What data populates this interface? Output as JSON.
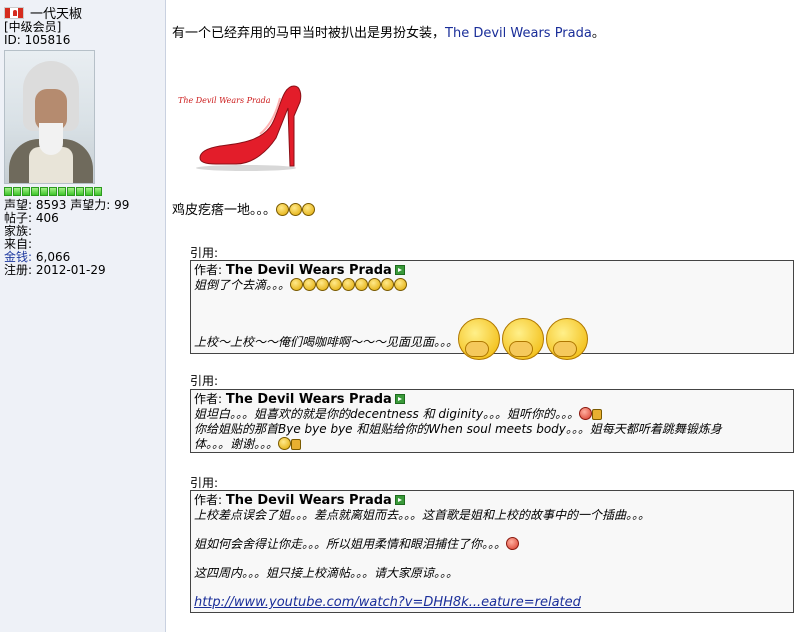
{
  "user": {
    "name": "一代天椒",
    "rank": "[中级会员]",
    "id_line": "ID: 105816",
    "stats": [
      {
        "label": "声望:",
        "value": "8593",
        "label2": "声望力:",
        "value2": "99"
      },
      {
        "label": "帖子:",
        "value": "406"
      },
      {
        "label": "家族:",
        "value": ""
      },
      {
        "label": "来自:",
        "value": ""
      },
      {
        "label": "金钱:",
        "value": "6,066",
        "label_link": true
      },
      {
        "label": "注册:",
        "value": "2012-01-29"
      }
    ],
    "reputation_bar_segments": 11,
    "flag": "canada-flag-icon"
  },
  "post": {
    "intro_text": "有一个已经弃用的马甲当时被扒出是男扮女装，",
    "intro_link": "The Devil Wears Prada",
    "intro_end": "。",
    "image_caption": "The Devil Wears Prada",
    "reaction_text": "鸡皮疙瘩一地。。。",
    "quotes": [
      {
        "label": "引用:",
        "author_prefix": "作者:",
        "author": "The Devil Wears Prada",
        "lines": [
          "姐倒了个去滴。。。",
          "",
          "上校～上校～～俺们喝咖啡啊～～～见面见面。。。"
        ]
      },
      {
        "label": "引用:",
        "author_prefix": "作者:",
        "author": "The Devil Wears Prada",
        "lines": [
          "姐坦白。。。姐喜欢的就是你的decentness 和 diginity。。。姐听你的。。。",
          "你给姐贴的那首Bye bye bye 和姐贴给你的When soul meets body。。。姐每天都听着跳舞锻炼身",
          "体。。。谢谢。。。"
        ]
      },
      {
        "label": "引用:",
        "author_prefix": "作者:",
        "author": "The Devil Wears Prada",
        "lines": [
          "上校差点误会了姐。。。差点就离姐而去。。。这首歌是姐和上校的故事中的一个插曲。。。",
          "",
          "姐如何会舍得让你走。。。所以姐用柔情和眼泪捕住了你。。。",
          "",
          "这四周内。。。姐只接上校滴帖。。。请大家原谅。。。",
          ""
        ],
        "link": "http://www.youtube.com/watch?v=DHH8k...eature=related"
      }
    ]
  },
  "colors": {
    "sidebar_bg": "#eef1f7",
    "link": "#1a2e99",
    "quote_bg": "#f8f8f8"
  }
}
